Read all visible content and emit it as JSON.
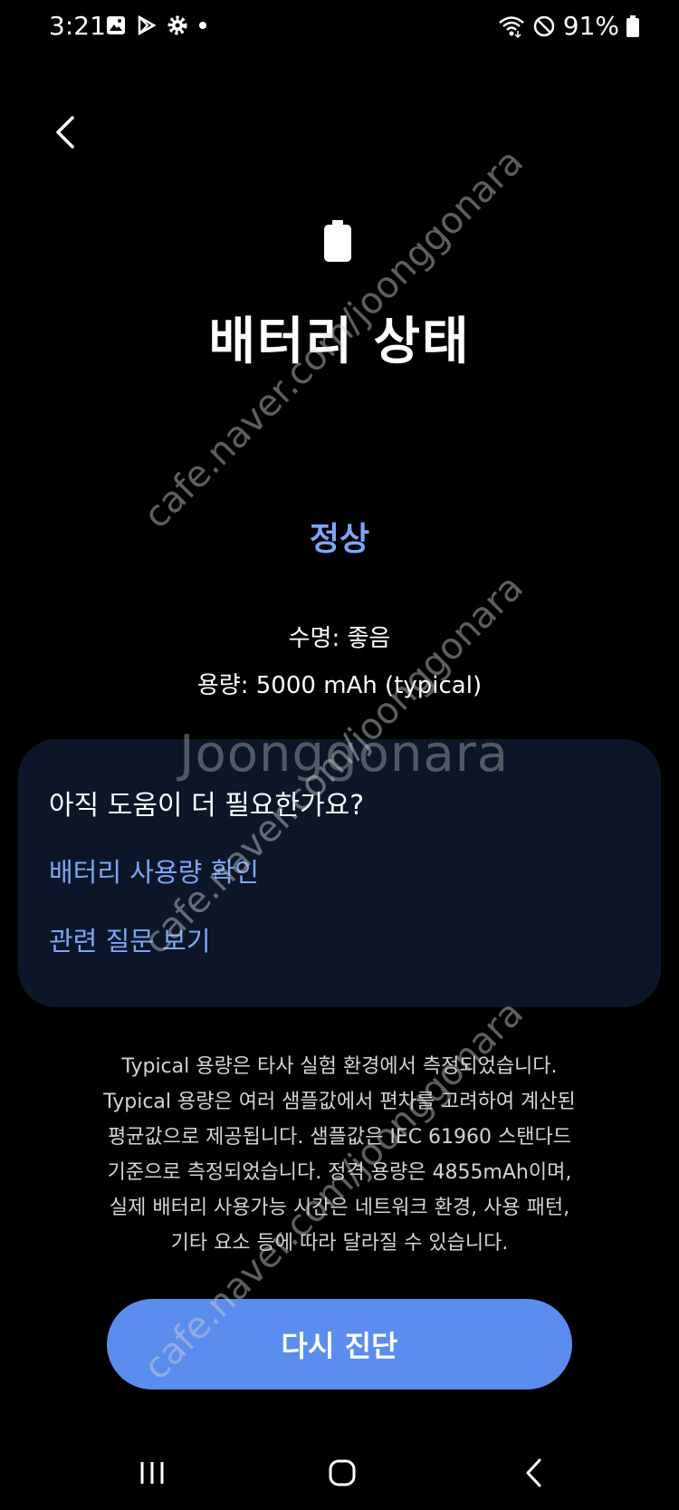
{
  "status_bar": {
    "time": "3:21",
    "battery_percent": "91%",
    "left_icons": [
      "gallery-icon",
      "play-store-icon",
      "settings-gear-icon",
      "dot-icon"
    ],
    "right_icons": [
      "wifi-icon",
      "do-not-disturb-icon",
      "battery-icon"
    ]
  },
  "header": {
    "back_icon": "chevron-left-icon"
  },
  "battery": {
    "title": "배터리 상태",
    "status": "정상",
    "lifespan": "수명: 좋음",
    "capacity": "용량: 5000 mAh (typical)",
    "status_color": "#7ea6f7"
  },
  "help": {
    "title": "아직 도움이 더 필요한가요?",
    "link_usage": "배터리 사용량 확인",
    "link_faq": "관련 질문 보기"
  },
  "footnote": {
    "lines": [
      "Typical 용량은 타사 실험 환경에서 측정되었습니다.",
      "Typical 용량은 여러 샘플값에서 편차를 고려하여 계산된",
      "평균값으로 제공됩니다. 샘플값은 IEC 61960 스탠다드",
      "기준으로 측정되었습니다. 정격 용량은 4855mAh이며,",
      "실제 배터리 사용가능 시간은 네트워크 환경, 사용 패턴,",
      "기타 요소 등에 따라 달라질 수 있습니다."
    ]
  },
  "actions": {
    "diagnose_label": "다시 진단",
    "button_color": "#5b8def"
  },
  "watermark": {
    "logo": "Joonggonara",
    "url": "cafe.naver.com/joonggonara"
  },
  "nav_bar": {
    "icons": [
      "recent-apps-icon",
      "home-icon",
      "back-icon"
    ]
  }
}
